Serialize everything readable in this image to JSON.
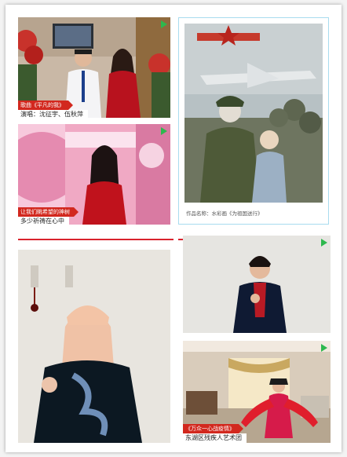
{
  "tiles": {
    "duet": {
      "tag": "歌曲《平凡的我》",
      "subtitle": "演唱：沈征宇、伍秋萍"
    },
    "singer_pink": {
      "tag": "让我们眺希望的神树",
      "subtitle": "多少祈祷在心中"
    },
    "painting": {
      "caption": "作品名称：水彩画《为祖国送行》"
    },
    "dance": {
      "tag": "《万众一心战疫情》",
      "subtitle": "东湖区残疾人艺术团"
    }
  },
  "colors": {
    "accent": "#d2281e",
    "play": "#2db84d",
    "frame": "#a8dcef"
  },
  "icons": {
    "play": "play-icon"
  }
}
